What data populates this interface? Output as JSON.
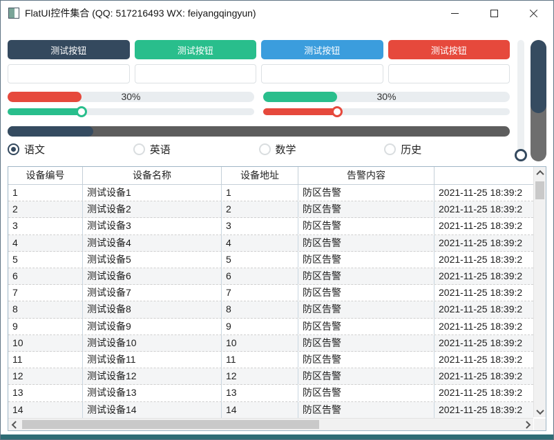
{
  "window": {
    "title": "FlatUI控件集合 (QQ: 517216493 WX: feiyangqingyun)"
  },
  "colors": {
    "navy": "#34495e",
    "green": "#29be8c",
    "blue": "#3b9ddd",
    "red": "#e6493c",
    "track_light": "#e9edf0",
    "track_dark": "#6e6e6e",
    "bottom_strip": "#2e6c75"
  },
  "toolbar": {
    "buttons": [
      {
        "label": "测试按钮",
        "color": "#34495e"
      },
      {
        "label": "测试按钮",
        "color": "#29be8c"
      },
      {
        "label": "测试按钮",
        "color": "#3b9ddd"
      },
      {
        "label": "测试按钮",
        "color": "#e6493c"
      }
    ]
  },
  "inputs": [
    {
      "value": "",
      "placeholder": ""
    },
    {
      "value": "",
      "placeholder": ""
    },
    {
      "value": "",
      "placeholder": ""
    },
    {
      "value": "",
      "placeholder": ""
    }
  ],
  "progress_bars": {
    "left": {
      "value": 30,
      "label": "30%",
      "fill_color": "#e6493c"
    },
    "right": {
      "value": 30,
      "label": "30%",
      "fill_color": "#29be8c"
    }
  },
  "sliders": {
    "left": {
      "value": 30,
      "fill_color": "#29be8c"
    },
    "right": {
      "value": 30,
      "fill_color": "#e6493c"
    }
  },
  "dark_progress": {
    "value": 17
  },
  "vertical_slider": {
    "value": 0
  },
  "vertical_progress": {
    "value": 60
  },
  "radios": [
    {
      "label": "语文",
      "selected": true
    },
    {
      "label": "英语",
      "selected": false
    },
    {
      "label": "数学",
      "selected": false
    },
    {
      "label": "历史",
      "selected": false
    }
  ],
  "table": {
    "headers": [
      "设备编号",
      "设备名称",
      "设备地址",
      "告警内容",
      ""
    ],
    "col_keys": [
      "id",
      "name",
      "addr",
      "alarm",
      "time"
    ],
    "rows": [
      {
        "id": "1",
        "name": "测试设备1",
        "addr": "1",
        "alarm": "防区告警",
        "time": "2021-11-25 18:39:2"
      },
      {
        "id": "2",
        "name": "测试设备2",
        "addr": "2",
        "alarm": "防区告警",
        "time": "2021-11-25 18:39:2"
      },
      {
        "id": "3",
        "name": "测试设备3",
        "addr": "3",
        "alarm": "防区告警",
        "time": "2021-11-25 18:39:2"
      },
      {
        "id": "4",
        "name": "测试设备4",
        "addr": "4",
        "alarm": "防区告警",
        "time": "2021-11-25 18:39:2"
      },
      {
        "id": "5",
        "name": "测试设备5",
        "addr": "5",
        "alarm": "防区告警",
        "time": "2021-11-25 18:39:2"
      },
      {
        "id": "6",
        "name": "测试设备6",
        "addr": "6",
        "alarm": "防区告警",
        "time": "2021-11-25 18:39:2"
      },
      {
        "id": "7",
        "name": "测试设备7",
        "addr": "7",
        "alarm": "防区告警",
        "time": "2021-11-25 18:39:2"
      },
      {
        "id": "8",
        "name": "测试设备8",
        "addr": "8",
        "alarm": "防区告警",
        "time": "2021-11-25 18:39:2"
      },
      {
        "id": "9",
        "name": "测试设备9",
        "addr": "9",
        "alarm": "防区告警",
        "time": "2021-11-25 18:39:2"
      },
      {
        "id": "10",
        "name": "测试设备10",
        "addr": "10",
        "alarm": "防区告警",
        "time": "2021-11-25 18:39:2"
      },
      {
        "id": "11",
        "name": "测试设备11",
        "addr": "11",
        "alarm": "防区告警",
        "time": "2021-11-25 18:39:2"
      },
      {
        "id": "12",
        "name": "测试设备12",
        "addr": "12",
        "alarm": "防区告警",
        "time": "2021-11-25 18:39:2"
      },
      {
        "id": "13",
        "name": "测试设备13",
        "addr": "13",
        "alarm": "防区告警",
        "time": "2021-11-25 18:39:2"
      },
      {
        "id": "14",
        "name": "测试设备14",
        "addr": "14",
        "alarm": "防区告警",
        "time": "2021-11-25 18:39:2"
      }
    ]
  }
}
